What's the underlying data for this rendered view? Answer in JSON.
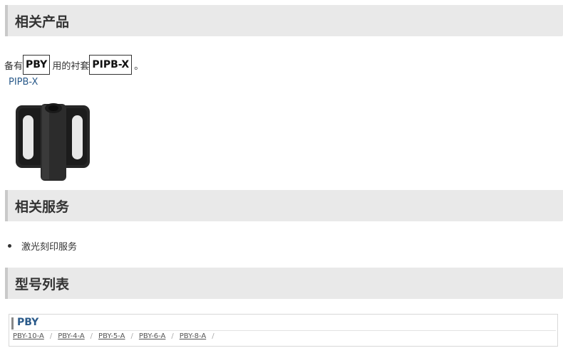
{
  "sections": {
    "related_products_title": "相关产品",
    "related_services_title": "相关服务",
    "model_list_title": "型号列表"
  },
  "description": {
    "prefix": "备有",
    "product": "PBY",
    "middle": "用的衬套",
    "accessory": "PIPB-X",
    "suffix": "。"
  },
  "product_link": "PIPB-X",
  "services": [
    {
      "label": "激光刻印服务"
    }
  ],
  "model_group": {
    "title": "PBY",
    "models": [
      "PBY-10-A",
      "PBY-4-A",
      "PBY-5-A",
      "PBY-6-A",
      "PBY-8-A"
    ],
    "separator": "/"
  },
  "colors": {
    "header_bg": "#e9e9e9",
    "link": "#2a5a8a"
  },
  "icons": {
    "product_image": "bushing-product-image",
    "bullet": "bullet-dot-icon"
  }
}
